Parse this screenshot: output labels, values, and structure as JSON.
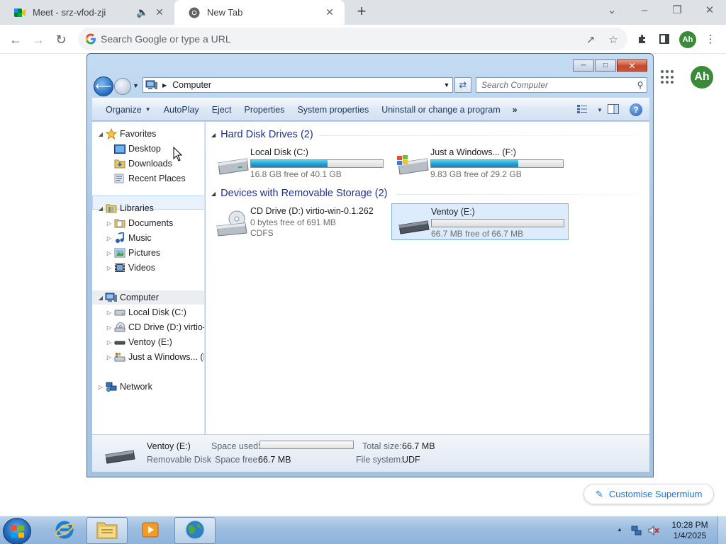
{
  "browser": {
    "tabs": [
      {
        "title": "Meet - srz-vfod-zji",
        "active": false
      },
      {
        "title": "New Tab",
        "active": true
      }
    ],
    "omnibox_placeholder": "Search Google or type a URL",
    "profile_initials": "Ah",
    "customise_label": "Customise Supermium"
  },
  "explorer": {
    "address": "Computer",
    "search_placeholder": "Search Computer",
    "commands": [
      "Organize",
      "AutoPlay",
      "Eject",
      "Properties",
      "System properties",
      "Uninstall or change a program"
    ],
    "more_label": "»",
    "nav": {
      "favorites": "Favorites",
      "desktop": "Desktop",
      "downloads": "Downloads",
      "recent": "Recent Places",
      "libraries": "Libraries",
      "documents": "Documents",
      "music": "Music",
      "pictures": "Pictures",
      "videos": "Videos",
      "computer": "Computer",
      "local_disk": "Local Disk (C:)",
      "cd_drive": "CD Drive (D:) virtio-w",
      "ventoy": "Ventoy (E:)",
      "just_windows": "Just a Windows... (F:",
      "network": "Network"
    },
    "groups": {
      "hdd_title": "Hard Disk Drives (2)",
      "removable_title": "Devices with Removable Storage (2)"
    },
    "drives": {
      "c": {
        "name": "Local Disk (C:)",
        "free_text": "16.8 GB free of 40.1 GB",
        "used_fraction": 0.58
      },
      "f": {
        "name": "Just a Windows... (F:)",
        "free_text": "9.83 GB free of 29.2 GB",
        "used_fraction": 0.66
      },
      "d": {
        "name": "CD Drive (D:) virtio-win-0.1.262",
        "free_text": "0 bytes free of 691 MB",
        "fs": "CDFS"
      },
      "e": {
        "name": "Ventoy (E:)",
        "free_text": "66.7 MB free of 66.7 MB",
        "used_fraction": 0.0
      }
    },
    "details": {
      "name": "Ventoy (E:)",
      "type": "Removable Disk",
      "space_used_label": "Space used:",
      "space_free_label": "Space free:",
      "space_free_value": "66.7 MB",
      "total_size_label": "Total size:",
      "total_size_value": "66.7 MB",
      "file_system_label": "File system:",
      "file_system_value": "UDF",
      "used_fraction": 0.0
    }
  },
  "taskbar": {
    "time": "10:28 PM",
    "date": "1/4/2025"
  },
  "colors": {
    "chrome_tab_bg": "#dee1e6",
    "accent_blue": "#1a73e8",
    "avatar_green": "#3a8a3a",
    "drive_bar": "#26a0da",
    "group_header": "#1e3287"
  }
}
